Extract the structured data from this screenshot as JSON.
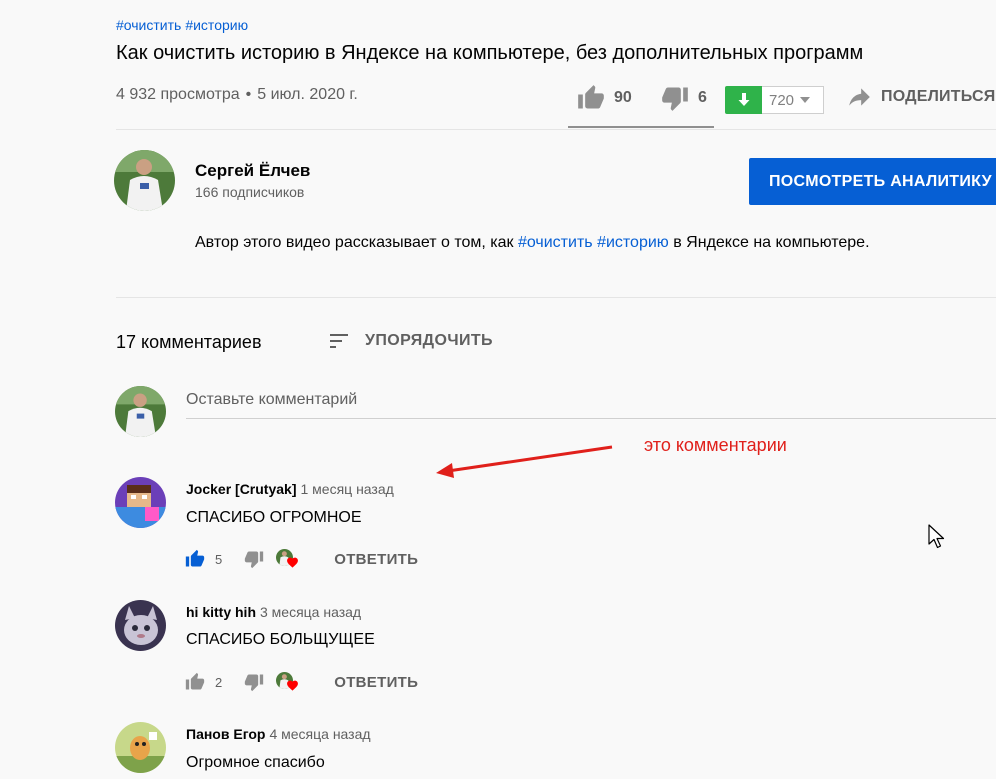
{
  "video": {
    "tags": [
      "#очистить",
      "#историю"
    ],
    "title": "Как очистить историю в Яндексе на компьютере, без дополнительных программ",
    "views": "4 932 просмотра",
    "date": "5 июл. 2020 г.",
    "likes": "90",
    "dislikes": "6",
    "downloads": "720",
    "share_label": "ПОДЕЛИТЬСЯ"
  },
  "channel": {
    "name": "Сергей Ёлчев",
    "subscribers": "166 подписчиков",
    "analytics_button": "ПОСМОТРЕТЬ АНАЛИТИКУ"
  },
  "description": {
    "part1": "Автор этого видео рассказывает о том, как ",
    "tag1": "#очистить",
    "tag2": "#историю",
    "part2": " в Яндексе на компьютере."
  },
  "comments_section": {
    "count_label": "17 комментариев",
    "sort_label": "УПОРЯДОЧИТЬ",
    "input_placeholder": "Оставьте комментарий",
    "annotation": "это комментарии",
    "reply_label": "ОТВЕТИТЬ",
    "items": [
      {
        "author": "Jocker [Crutyak]",
        "time": "1 месяц назад",
        "text": "СПАСИБО ОГРОМНОЕ",
        "likes": "5",
        "liked": true
      },
      {
        "author": "hi kitty hih",
        "time": "3 месяца назад",
        "text": "СПАСИБО БОЛЬЩУЩЕЕ",
        "likes": "2",
        "liked": false
      },
      {
        "author": "Панов Егор",
        "time": "4 месяца назад",
        "text": "Огромное спасибо",
        "likes": "",
        "liked": false
      }
    ]
  },
  "colors": {
    "link": "#065fd4",
    "primary_button": "#065fd4",
    "download_green": "#2fb34a",
    "annotation_red": "#e0201b",
    "heart_red": "#ff0000",
    "secondary_text": "#606060"
  },
  "icons": [
    "like-icon",
    "dislike-icon",
    "download-icon",
    "share-icon",
    "sort-icon",
    "heart-icon",
    "cursor-icon"
  ]
}
